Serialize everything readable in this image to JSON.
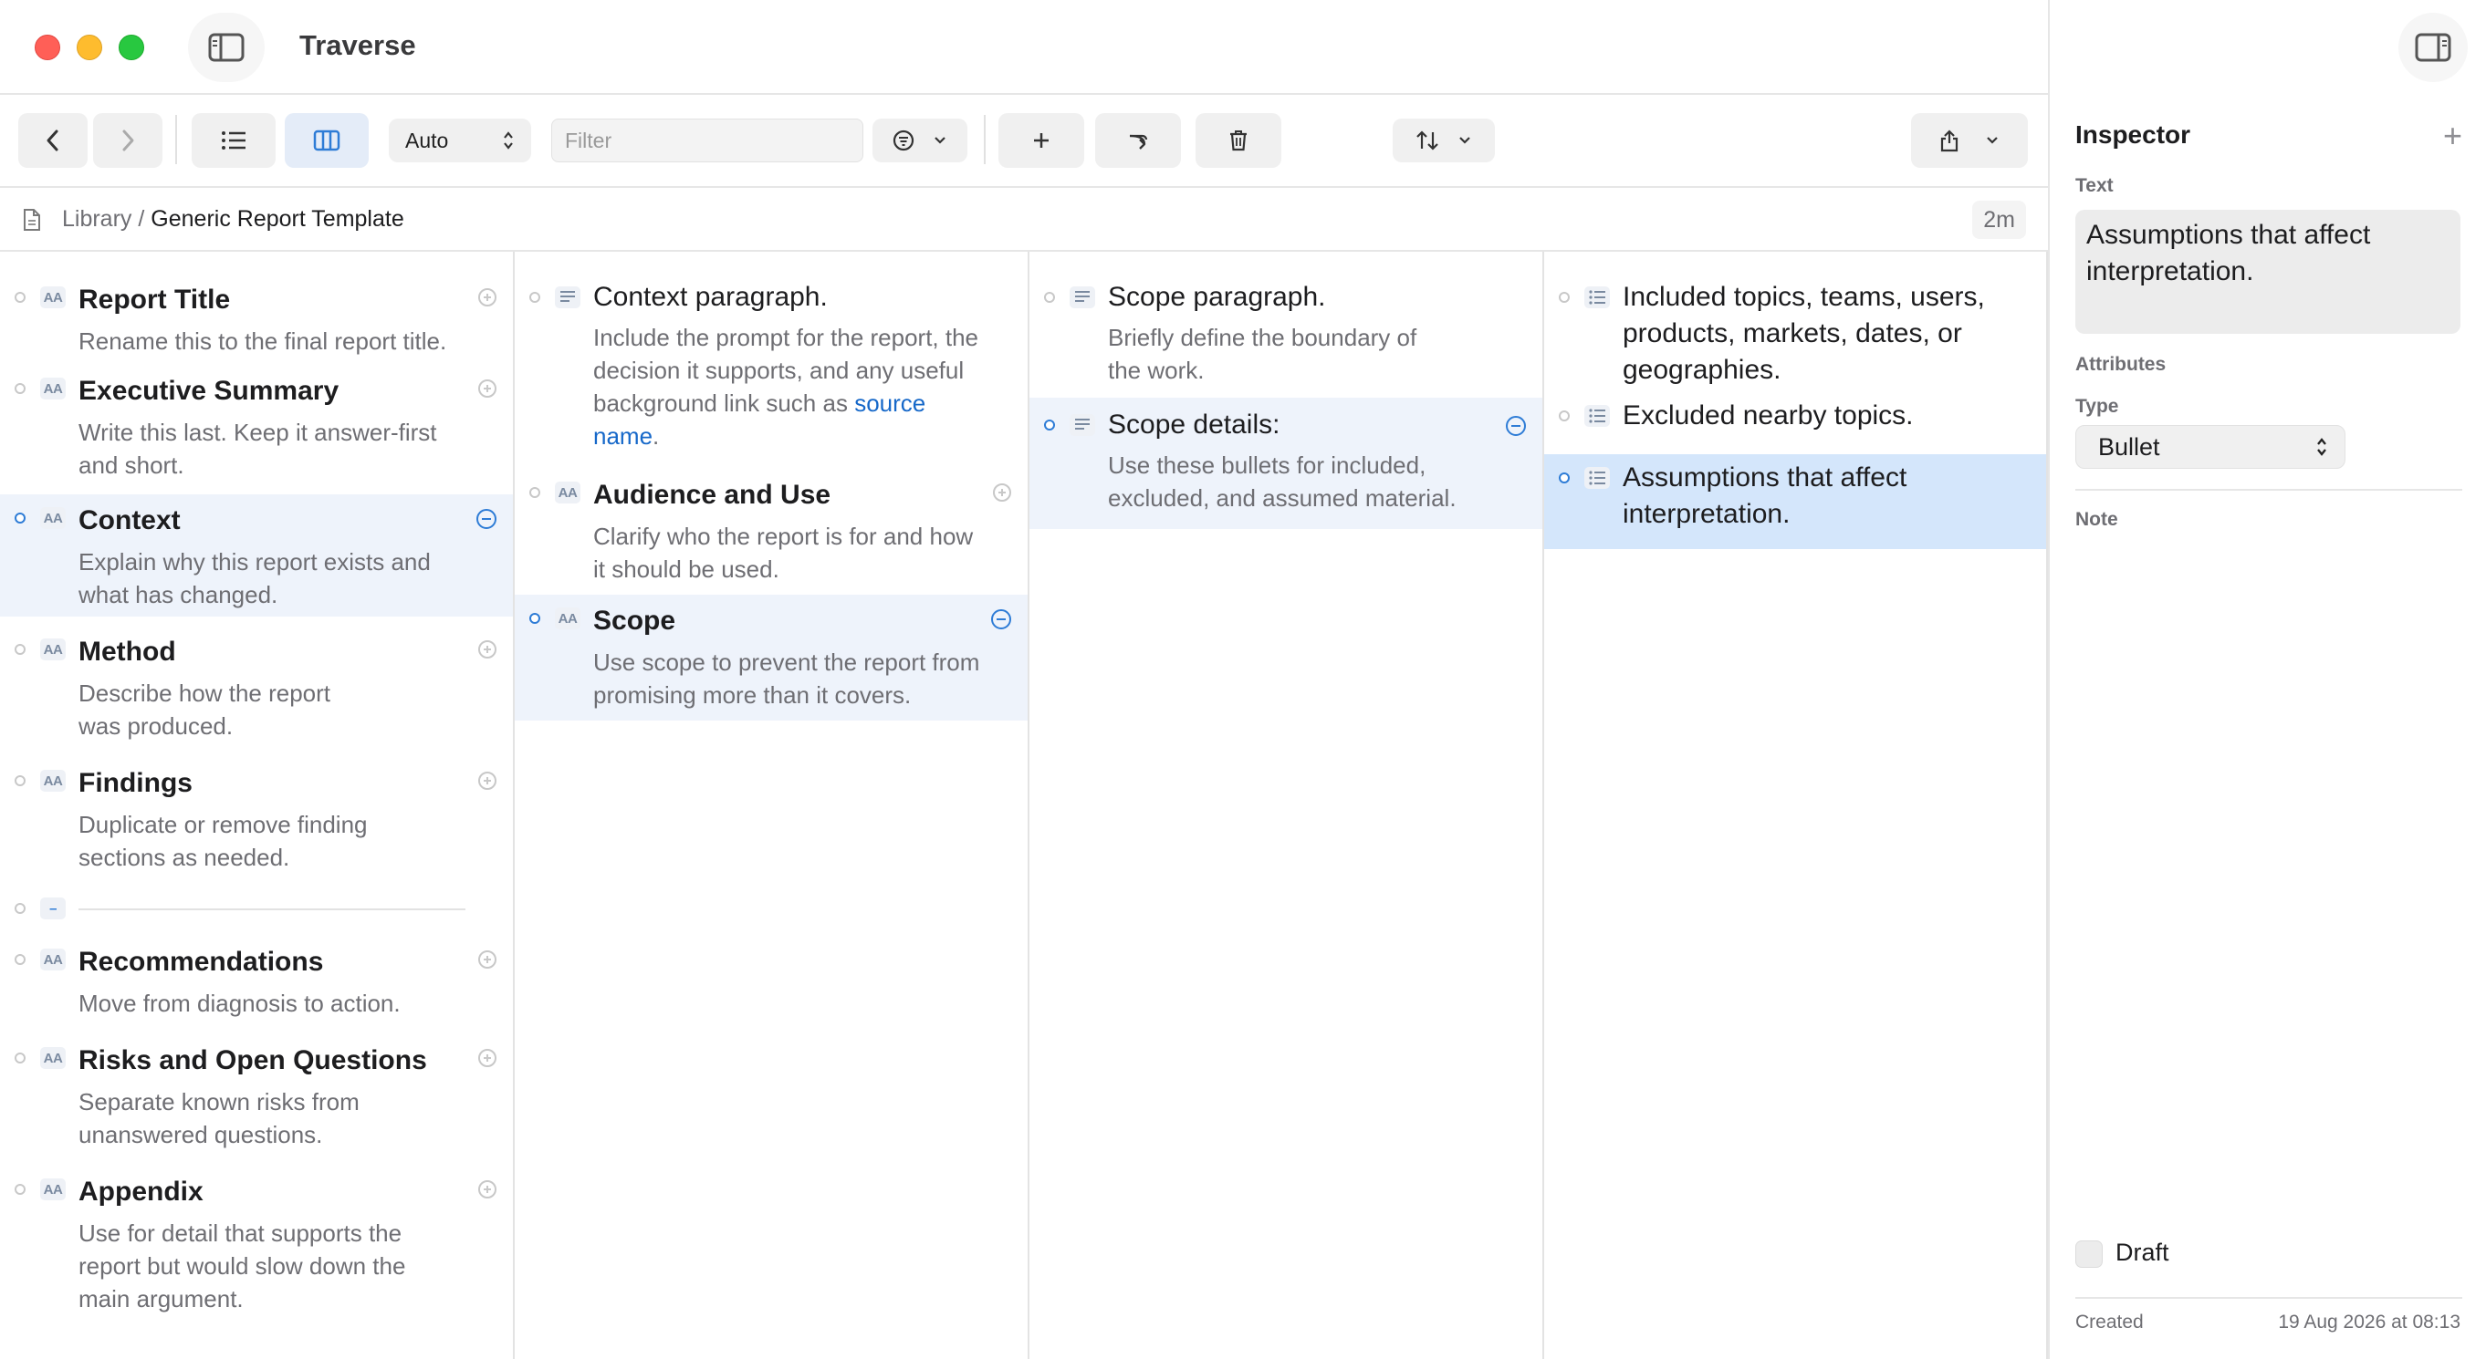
{
  "app": {
    "title": "Traverse"
  },
  "toolbar": {
    "view_mode": "Auto",
    "filter_placeholder": "Filter"
  },
  "path": {
    "root": "Library",
    "separator": "/",
    "current": "Generic Report Template",
    "time": "2m"
  },
  "columns": {
    "col1": [
      {
        "title": "Report Title",
        "desc": "Rename this to the final report title."
      },
      {
        "title": "Executive Summary",
        "desc": "Write this last. Keep it answer-first and short."
      },
      {
        "title": "Context",
        "desc": "Explain why this report exists and what has changed."
      },
      {
        "title": "Method",
        "desc": "Describe how the report was produced."
      },
      {
        "title": "Findings",
        "desc": "Duplicate or remove finding sections as needed."
      },
      {
        "title": "Recommendations",
        "desc": "Move from diagnosis to action."
      },
      {
        "title": "Risks and Open Questions",
        "desc": "Separate known risks from unanswered questions."
      },
      {
        "title": "Appendix",
        "desc": "Use for detail that supports the report but would slow down the main argument."
      }
    ],
    "col2": [
      {
        "title": "Context paragraph.",
        "desc": "Include the prompt for the report, the decision it supports, and any useful background link such as",
        "link": "source name",
        "after": "."
      },
      {
        "title": "Audience and Use",
        "desc": "Clarify who the report is for and how it should be used."
      },
      {
        "title": "Scope",
        "desc": "Use scope to prevent the report from promising more than it covers."
      }
    ],
    "col3": [
      {
        "title": "Scope paragraph.",
        "desc": "Briefly define the boundary of the work."
      },
      {
        "title": "Scope details:",
        "desc": "Use these bullets for included, excluded, and assumed material."
      }
    ],
    "col4": [
      {
        "title": "Included topics, teams, users, products, markets, dates, or geographies."
      },
      {
        "title": "Excluded nearby topics."
      },
      {
        "title": "Assumptions that affect interpretation."
      }
    ]
  },
  "type_icons": {
    "heading": "AA"
  },
  "inspector": {
    "title": "Inspector",
    "text_label": "Text",
    "text_value": "Assumptions that affect interpretation.",
    "attributes_label": "Attributes",
    "type_label": "Type",
    "type_value": "Bullet",
    "note_label": "Note",
    "draft_label": "Draft",
    "created_label": "Created",
    "created_value": "19 Aug 2026 at 08:13"
  },
  "colors": {
    "accent": "#2e7cd6",
    "selection": "#d4e6fb",
    "link": "#1668c9"
  }
}
